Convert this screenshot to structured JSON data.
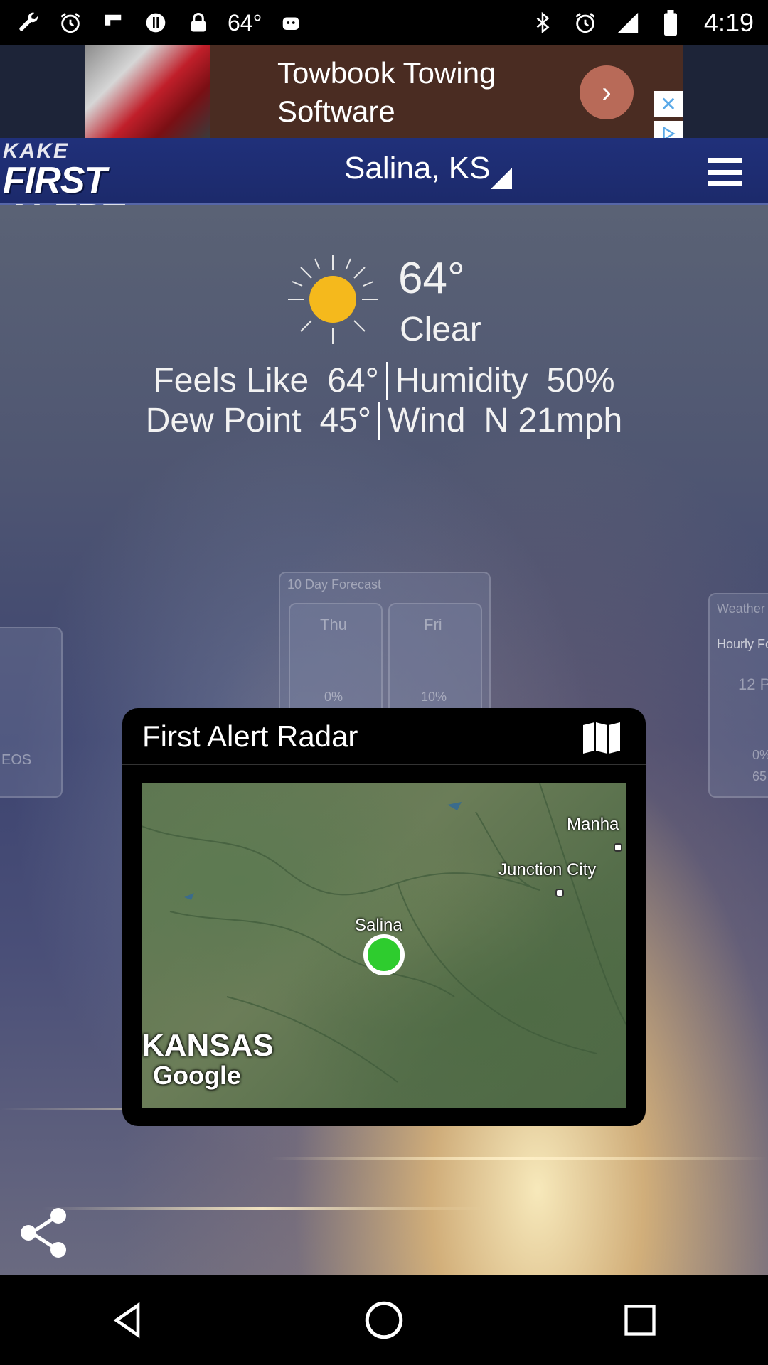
{
  "status_bar": {
    "temperature": "64°",
    "time": "4:19",
    "icons_left": [
      "wrench-icon",
      "alarm-icon",
      "flipboard-icon",
      "circle-icon",
      "lock-icon",
      "temperature-text",
      "android-icon"
    ],
    "icons_right": [
      "bluetooth-icon",
      "alarm-icon",
      "signal-icon",
      "battery-icon"
    ]
  },
  "ad": {
    "title": "Towbook Towing Software",
    "line1": "Towbook Towing",
    "line2": "Software",
    "arrow": "›",
    "close": "✕"
  },
  "header": {
    "logo_top": "KAKE",
    "logo_main": "FIRST ALERT",
    "location": "Salina, KS"
  },
  "current": {
    "temperature": "64°",
    "condition": "Clear",
    "feels_like_label": "Feels Like",
    "feels_like_value": "64°",
    "humidity_label": "Humidity",
    "humidity_value": "50%",
    "dew_point_label": "Dew Point",
    "dew_point_value": "45°",
    "wind_label": "Wind",
    "wind_value": "N 21mph"
  },
  "background_cards": {
    "forecast_title": "10 Day Forecast",
    "day1": "Thu",
    "day1_precip": "0%",
    "day2": "Fri",
    "day2_precip": "10%",
    "left_label": "EOS",
    "right_title": "Weather",
    "right_sub": "Hourly Fo",
    "right_temp": "12 P",
    "right_precip": "0%",
    "right_value": "65"
  },
  "radar": {
    "title": "First Alert Radar",
    "map_labels": {
      "manhattan": "Manha",
      "junction_city": "Junction City",
      "salina": "Salina",
      "state": "KANSAS",
      "attribution": "Google"
    }
  },
  "colors": {
    "appbar": "#20307a",
    "sun": "#f5b91c",
    "pin": "#2ecc2e"
  }
}
